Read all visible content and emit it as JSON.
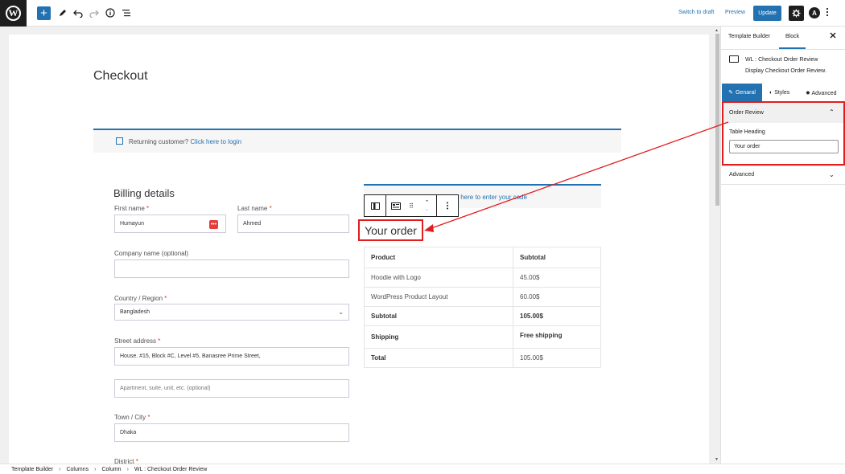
{
  "topbar": {
    "logo_letter": "W",
    "add_symbol": "+",
    "switch_to_draft": "Switch to draft",
    "preview": "Preview",
    "update": "Update",
    "astra_letter": "A"
  },
  "page": {
    "title": "Checkout",
    "notice_text": "Returning customer?",
    "notice_link": "Click here to login"
  },
  "billing": {
    "title": "Billing details",
    "first_name_label": "First name",
    "first_name_value": "Humayun",
    "last_name_label": "Last name",
    "last_name_value": "Ahmed",
    "company_label": "Company name (optional)",
    "country_label": "Country / Region",
    "country_value": "Bangladesh",
    "street_label": "Street address",
    "street_value": "House. #15, Block #C, Level #5, Banasree Prime Street,",
    "apartment_placeholder": "Apartment, suite, unit, etc. (optional)",
    "city_label": "Town / City",
    "city_value": "Dhaka",
    "district_label": "District",
    "required_mark": "*"
  },
  "coupon": {
    "text": "k here to enter your code"
  },
  "order": {
    "heading": "Your order",
    "header_product": "Product",
    "header_subtotal": "Subtotal",
    "rows": [
      {
        "product": "Hoodie with Logo",
        "subtotal": "45.00$"
      },
      {
        "product": "WordPress Product Layout",
        "subtotal": "60.00$"
      }
    ],
    "subtotal_label": "Subtotal",
    "subtotal_value": "105.00$",
    "shipping_label": "Shipping",
    "shipping_value": "Free shipping",
    "total_label": "Total",
    "total_value": "105.00$"
  },
  "sidebar": {
    "tab_template_builder": "Template Builder",
    "tab_block": "Block",
    "block_title": "WL : Checkout Order Review",
    "block_desc": "Display Checkout Order Review.",
    "tab_general": "Genaral",
    "tab_styles": "Styles",
    "tab_advanced": "Advanced",
    "panel_title": "Order Review",
    "table_heading_label": "Table Heading",
    "table_heading_value": "Your order",
    "advanced_panel": "Advanced"
  },
  "breadcrumb": {
    "items": [
      "Template Builder",
      "Columns",
      "Column",
      "WL : Checkout Order Review"
    ]
  },
  "colors": {
    "accent": "#2271b1",
    "highlight": "#e11d1d",
    "dark": "#1e1e1e"
  }
}
